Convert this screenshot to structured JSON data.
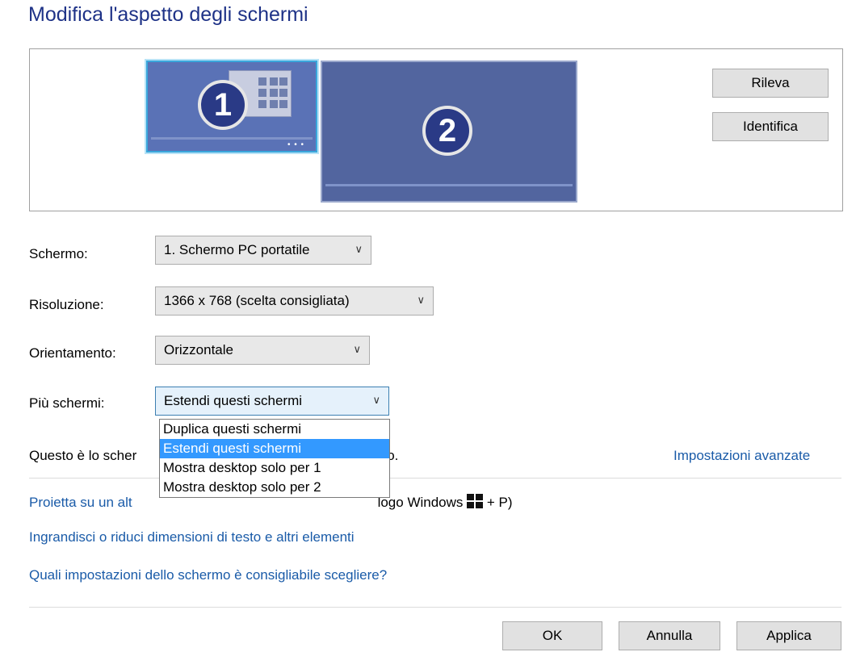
{
  "title": "Modifica l'aspetto degli schermi",
  "monitors": [
    {
      "number": "1",
      "selected": true
    },
    {
      "number": "2",
      "selected": false
    }
  ],
  "side_buttons": {
    "detect": "Rileva",
    "identify": "Identifica"
  },
  "fields": {
    "screen": {
      "label": "Schermo:",
      "value": "1. Schermo PC portatile"
    },
    "resolution": {
      "label": "Risoluzione:",
      "value": "1366 x 768 (scelta consigliata)"
    },
    "orientation": {
      "label": "Orientamento:",
      "value": "Orizzontale"
    },
    "multiple": {
      "label": "Più schermi:",
      "value": "Estendi questi schermi"
    }
  },
  "dropdown_options": [
    "Duplica questi schermi",
    "Estendi questi schermi",
    "Mostra desktop solo per 1",
    "Mostra desktop solo per 2"
  ],
  "dropdown_selected_index": 1,
  "info": {
    "text_start": "Questo è lo scher",
    "text_end": "uso."
  },
  "advanced_link": "Impostazioni avanzate",
  "links": {
    "project_start": "Proietta su un alt",
    "project_end": "logo Windows",
    "project_tail": "+ P)",
    "resize": "Ingrandisci o riduci dimensioni di testo e altri elementi",
    "which_settings": "Quali impostazioni dello schermo è consigliabile scegliere?"
  },
  "buttons": {
    "ok": "OK",
    "cancel": "Annulla",
    "apply": "Applica"
  },
  "colors": {
    "accent": "#3399ff",
    "link": "#1a5ba8",
    "title": "#1e3287"
  }
}
